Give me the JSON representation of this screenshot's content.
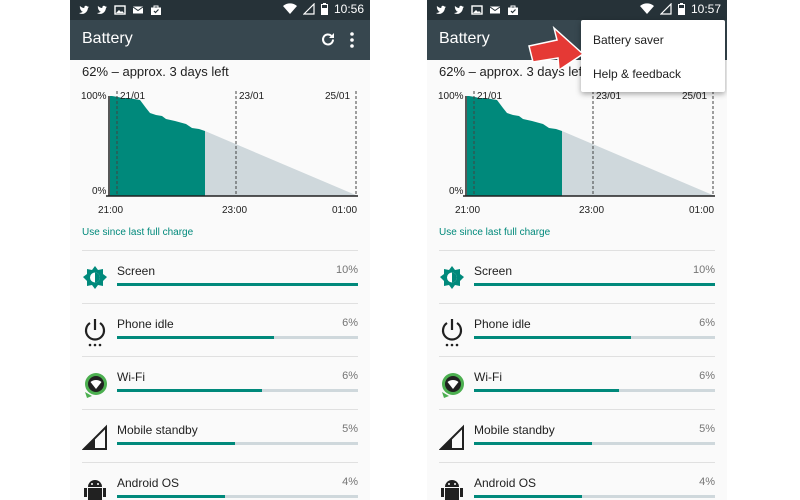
{
  "screens": [
    {
      "time": "10:56",
      "title": "Battery",
      "headline": "62% – approx. 3 days left",
      "chart": {
        "y_top": "100%",
        "y_bottom": "0%",
        "dates": [
          "21/01",
          "23/01",
          "25/01"
        ],
        "times": [
          "21:00",
          "23:00",
          "01:00"
        ]
      },
      "section": "Use since last full charge",
      "menu_open": false
    },
    {
      "time": "10:57",
      "title": "Battery",
      "headline": "62% – approx. 3 days left",
      "chart": {
        "y_top": "100%",
        "y_bottom": "0%",
        "dates": [
          "21/01",
          "23/01",
          "25/01"
        ],
        "times": [
          "21:00",
          "23:00",
          "01:00"
        ]
      },
      "section": "Use since last full charge",
      "menu_open": true,
      "menu": [
        "Battery saver",
        "Help & feedback"
      ]
    }
  ],
  "usage": [
    {
      "label": "Screen",
      "pct": "10%",
      "fraction": 1.0,
      "icon": "brightness-icon"
    },
    {
      "label": "Phone idle",
      "pct": "6%",
      "fraction": 0.65,
      "icon": "power-icon"
    },
    {
      "label": "Wi-Fi",
      "pct": "6%",
      "fraction": 0.6,
      "icon": "wifi-icon"
    },
    {
      "label": "Mobile standby",
      "pct": "5%",
      "fraction": 0.49,
      "icon": "cell-signal-icon"
    },
    {
      "label": "Android OS",
      "pct": "4%",
      "fraction": 0.45,
      "icon": "android-icon"
    }
  ],
  "colors": {
    "accent": "#00897b",
    "toolbar": "#37474f",
    "statusbar": "#263238",
    "projection": "#cfd8dc",
    "arrow": "#e53935"
  }
}
